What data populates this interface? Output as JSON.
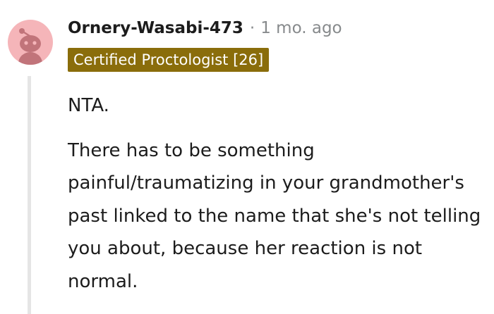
{
  "comment": {
    "author": "Ornery-Wasabi-473",
    "separator": "·",
    "timestamp": "1 mo. ago",
    "flair": "Certified Proctologist [26]",
    "paragraphs": [
      "NTA.",
      "There has to be something painful/traumatizing in your grandmother's past linked to the name that she's not telling you about, because her reaction is not normal."
    ],
    "avatar_icon": "snoo-avatar-icon",
    "colors": {
      "avatar_bg": "#f5b5b9",
      "avatar_figure": "#c1747a",
      "flair_bg": "#8a6d0b",
      "flair_text": "#ffffff",
      "meta_gray": "#878a8c",
      "thread_line": "#e5e5e5"
    }
  }
}
